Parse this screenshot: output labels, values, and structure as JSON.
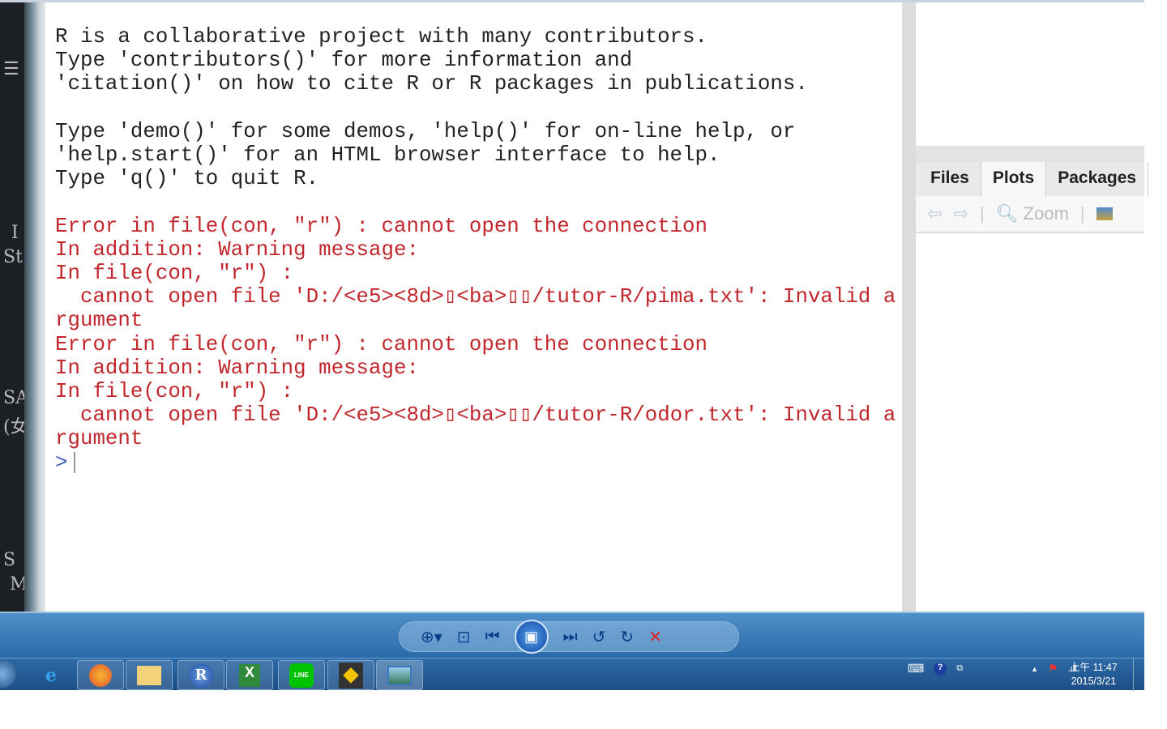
{
  "console": {
    "lines": [
      "R is a collaborative project with many contributors.",
      "Type 'contributors()' for more information and",
      "'citation()' on how to cite R or R packages in publications.",
      "",
      "Type 'demo()' for some demos, 'help()' for on-line help, or",
      "'help.start()' for an HTML browser interface to help.",
      "Type 'q()' to quit R.",
      ""
    ],
    "errors": [
      "Error in file(con, \"r\") : cannot open the connection",
      "In addition: Warning message:",
      "In file(con, \"r\") :",
      "  cannot open file 'D:/<e5><8d>▯<ba>▯▯/tutor-R/pima.txt': Invalid a",
      "rgument",
      "Error in file(con, \"r\") : cannot open the connection",
      "In addition: Warning message:",
      "In file(con, \"r\") :",
      "  cannot open file 'D:/<e5><8d>▯<ba>▯▯/tutor-R/odor.txt': Invalid a",
      "rgument"
    ],
    "prompt": ">"
  },
  "left_strip": [
    "☰",
    "I",
    "St",
    "SA",
    "(⼥",
    "S",
    "M"
  ],
  "right_pane": {
    "tabs": [
      "Files",
      "Plots",
      "Packages"
    ],
    "active_tab": "Plots",
    "zoom_label": "Zoom"
  },
  "photo_viewer": {
    "controls": [
      "zoom",
      "fit",
      "previous",
      "slideshow",
      "next",
      "rotate-left",
      "rotate-right",
      "delete"
    ]
  },
  "taskbar": {
    "apps": [
      "Internet Explorer",
      "Firefox",
      "File Explorer",
      "R",
      "Excel",
      "LINE",
      "App",
      "Photo Viewer"
    ],
    "r_label": "R",
    "line_label": "LINE",
    "time": "上午 11:47",
    "date": "2015/3/21"
  },
  "colors": {
    "error": "#c1272d",
    "prompt": "#3a5fb0",
    "taskbar": "#1d4f86"
  }
}
